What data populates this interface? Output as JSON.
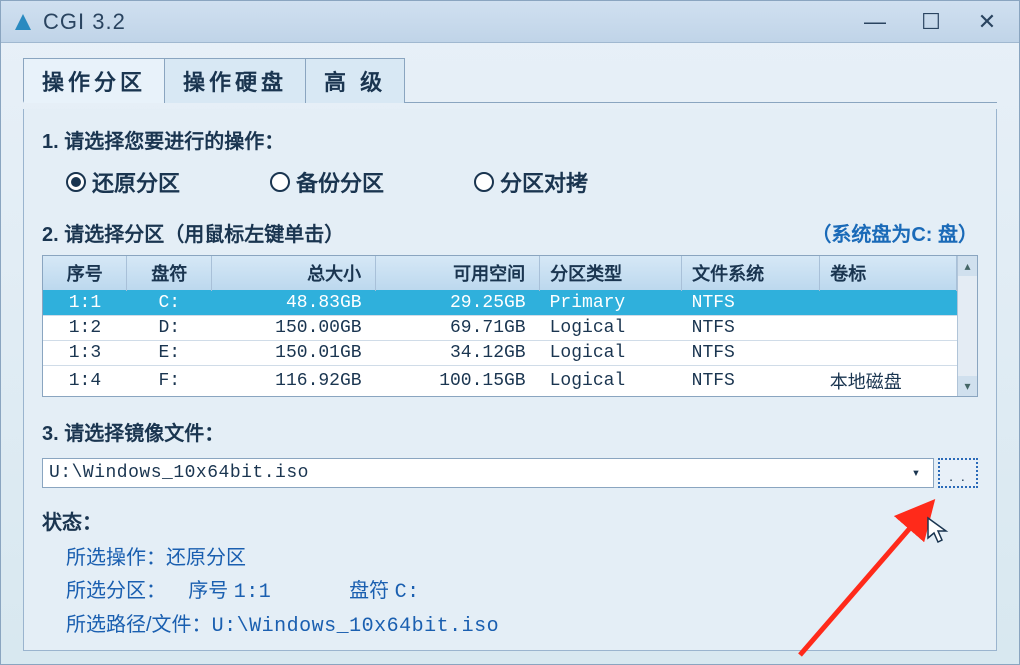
{
  "window": {
    "title": "CGI 3.2"
  },
  "tabs": {
    "t0": "操作分区",
    "t1": "操作硬盘",
    "t2": "高 级"
  },
  "step1": {
    "label": "1. 请选择您要进行的操作：",
    "opt_restore": "还原分区",
    "opt_backup": "备份分区",
    "opt_copy": "分区对拷"
  },
  "step2": {
    "label": "2. 请选择分区（用鼠标左键单击）",
    "hint": "（系统盘为C: 盘）"
  },
  "table": {
    "headers": {
      "idx": "序号",
      "drive": "盘符",
      "total": "总大小",
      "free": "可用空间",
      "ptype": "分区类型",
      "fs": "文件系统",
      "label": "卷标"
    },
    "rows": [
      {
        "idx": "1:1",
        "drive": "C:",
        "total": "48.83GB",
        "free": "29.25GB",
        "ptype": "Primary",
        "fs": "NTFS",
        "label": "",
        "selected": true
      },
      {
        "idx": "1:2",
        "drive": "D:",
        "total": "150.00GB",
        "free": "69.71GB",
        "ptype": "Logical",
        "fs": "NTFS",
        "label": ""
      },
      {
        "idx": "1:3",
        "drive": "E:",
        "total": "150.01GB",
        "free": "34.12GB",
        "ptype": "Logical",
        "fs": "NTFS",
        "label": ""
      },
      {
        "idx": "1:4",
        "drive": "F:",
        "total": "116.92GB",
        "free": "100.15GB",
        "ptype": "Logical",
        "fs": "NTFS",
        "label": "本地磁盘"
      }
    ]
  },
  "step3": {
    "label": "3. 请选择镜像文件：",
    "path": "U:\\Windows_10x64bit.iso"
  },
  "status": {
    "title": "状态：",
    "op_label": "所选操作：",
    "op_value": "还原分区",
    "part_label": "所选分区：",
    "part_idx_label": "序号",
    "part_idx_value": "1:1",
    "part_drive_label": "盘符",
    "part_drive_value": "C:",
    "path_label": "所选路径/文件：",
    "path_value": "U:\\Windows_10x64bit.iso"
  }
}
